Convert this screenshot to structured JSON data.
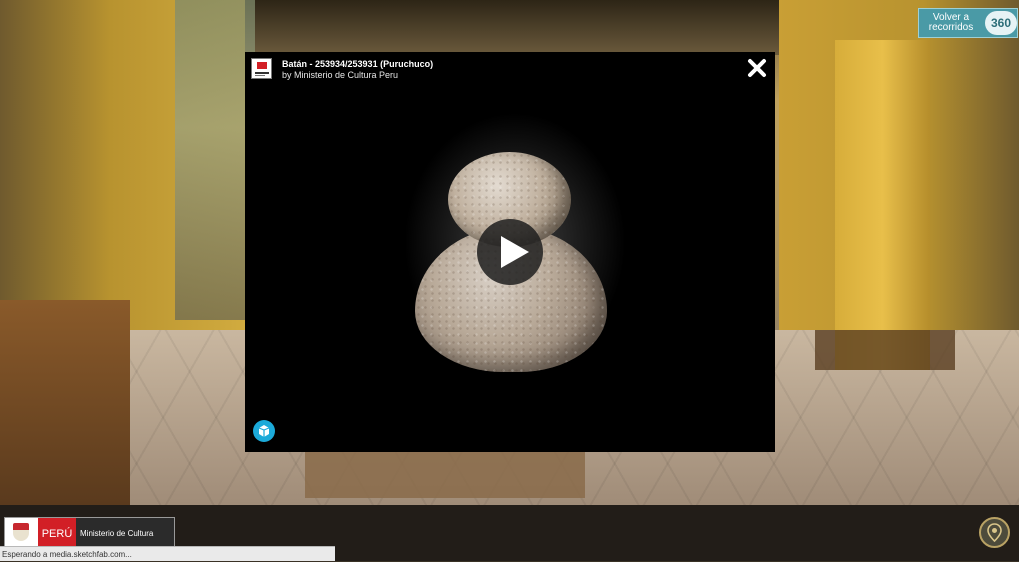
{
  "modal": {
    "title": "Batán - 253934/253931 (Puruchuco)",
    "byline": "by Ministerio de Cultura Peru",
    "close_icon": "close-icon",
    "play_icon": "play-icon",
    "logo_icon": "sketchfab-logo-icon"
  },
  "top_right_button": {
    "label": "Volver a recorridos",
    "badge": "360"
  },
  "footer": {
    "peru_label": "PERÚ",
    "ministry_label": "Ministerio de Cultura",
    "status_text": "Esperando a media.sketchfab.com...",
    "map_icon": "location-pin-icon"
  },
  "colors": {
    "sketchfab_blue": "#1caad9",
    "peru_red": "#d21f26",
    "volver_teal": "#4a9aa6"
  }
}
